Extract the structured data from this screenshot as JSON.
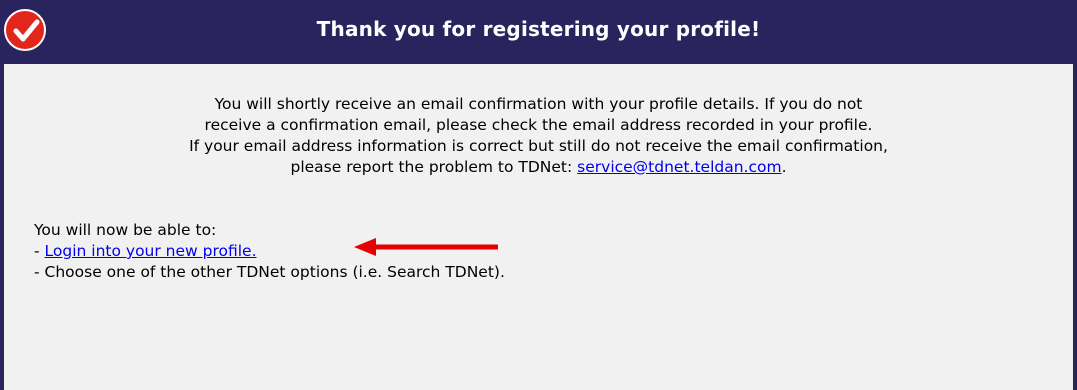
{
  "header": {
    "title": "Thank you for registering your profile!",
    "icon": "check-icon",
    "background_color": "#2a245e",
    "badge_color": "#e3261c"
  },
  "notice": {
    "line1": "You will shortly receive an email confirmation with your profile details. If you do not",
    "line2": "receive a confirmation email, please check the email address recorded in your profile.",
    "line3": "If your email address information is correct but still do not receive the email confirmation,",
    "line4_prefix": "please report the problem to TDNet: ",
    "email": "service@tdnet.teldan.com",
    "line4_suffix": "."
  },
  "options": {
    "intro": "You will now be able to:",
    "bullet": "- ",
    "login_link": "Login into your new profile.",
    "other_option": "- Choose one of the other TDNet options (i.e. Search TDNet)."
  },
  "annotation": {
    "icon": "red-arrow-icon",
    "color": "#e60000"
  }
}
